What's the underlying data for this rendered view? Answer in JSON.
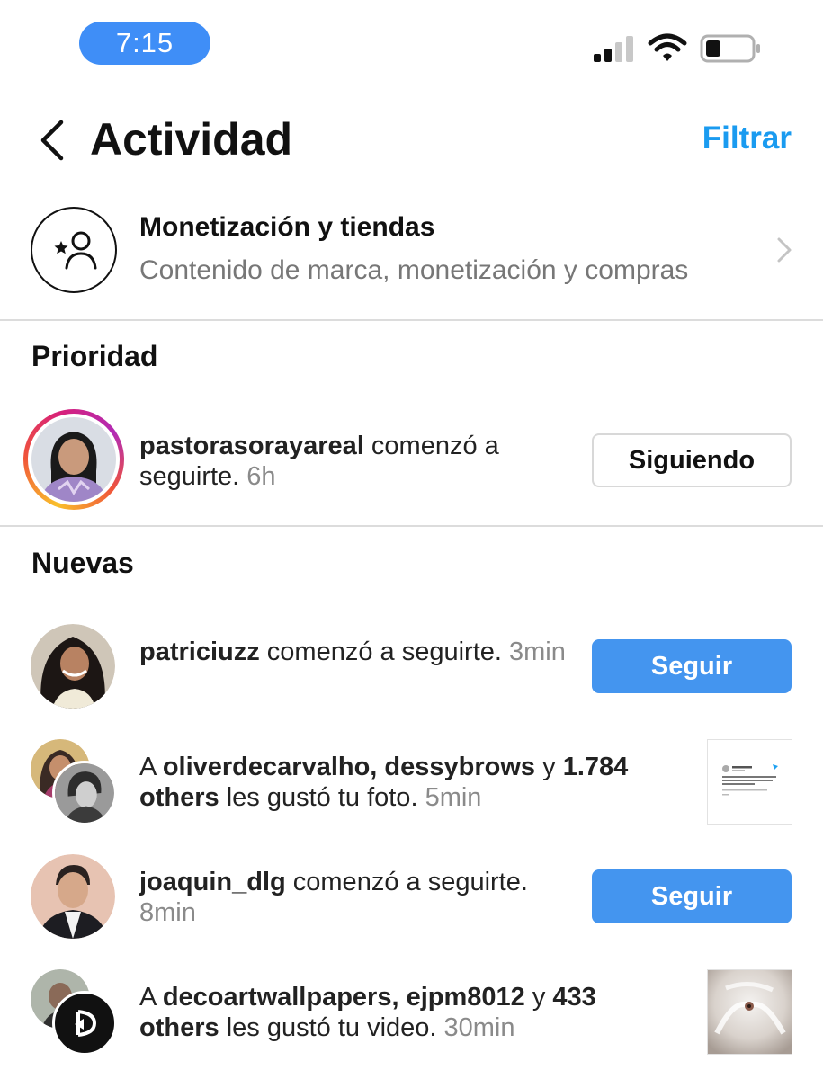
{
  "status_bar": {
    "time": "7:15",
    "icons": [
      "cellular-signal-icon",
      "wifi-icon",
      "battery-icon"
    ]
  },
  "header": {
    "title": "Actividad",
    "filter_label": "Filtrar",
    "back_icon": "chevron-left-icon"
  },
  "monetization": {
    "title": "Monetización y tiendas",
    "subtitle": "Contenido de marca, monetización y compras",
    "icon": "star-person-icon"
  },
  "sections": {
    "priority_title": "Prioridad",
    "new_title": "Nuevas"
  },
  "priority": [
    {
      "username": "pastorasorayareal",
      "text": " comenzó a seguirte. ",
      "time": "6h",
      "button": "Siguiendo"
    }
  ],
  "new": [
    {
      "username": "patriciuzz",
      "text": " comenzó a seguirte. ",
      "time": "3min",
      "button": "Seguir"
    },
    {
      "prefix": "A ",
      "users": "oliverdecarvalho, dessybrows",
      "middle": " y ",
      "others": "1.784 others",
      "text": " les gustó tu foto. ",
      "time": "5min"
    },
    {
      "username": "joaquin_dlg",
      "text": " comenzó a seguirte. ",
      "time": "8min",
      "button": "Seguir"
    },
    {
      "prefix": "A ",
      "users": "decoartwallpapers, ejpm8012",
      "middle": " y ",
      "others": "433 others",
      "text": " les gustó tu video. ",
      "time": "30min"
    }
  ],
  "colors": {
    "accent": "#1a9bf0",
    "follow_button": "#4495ef",
    "time_pill": "#3f8ef7",
    "secondary_text": "#8a8a8a"
  }
}
